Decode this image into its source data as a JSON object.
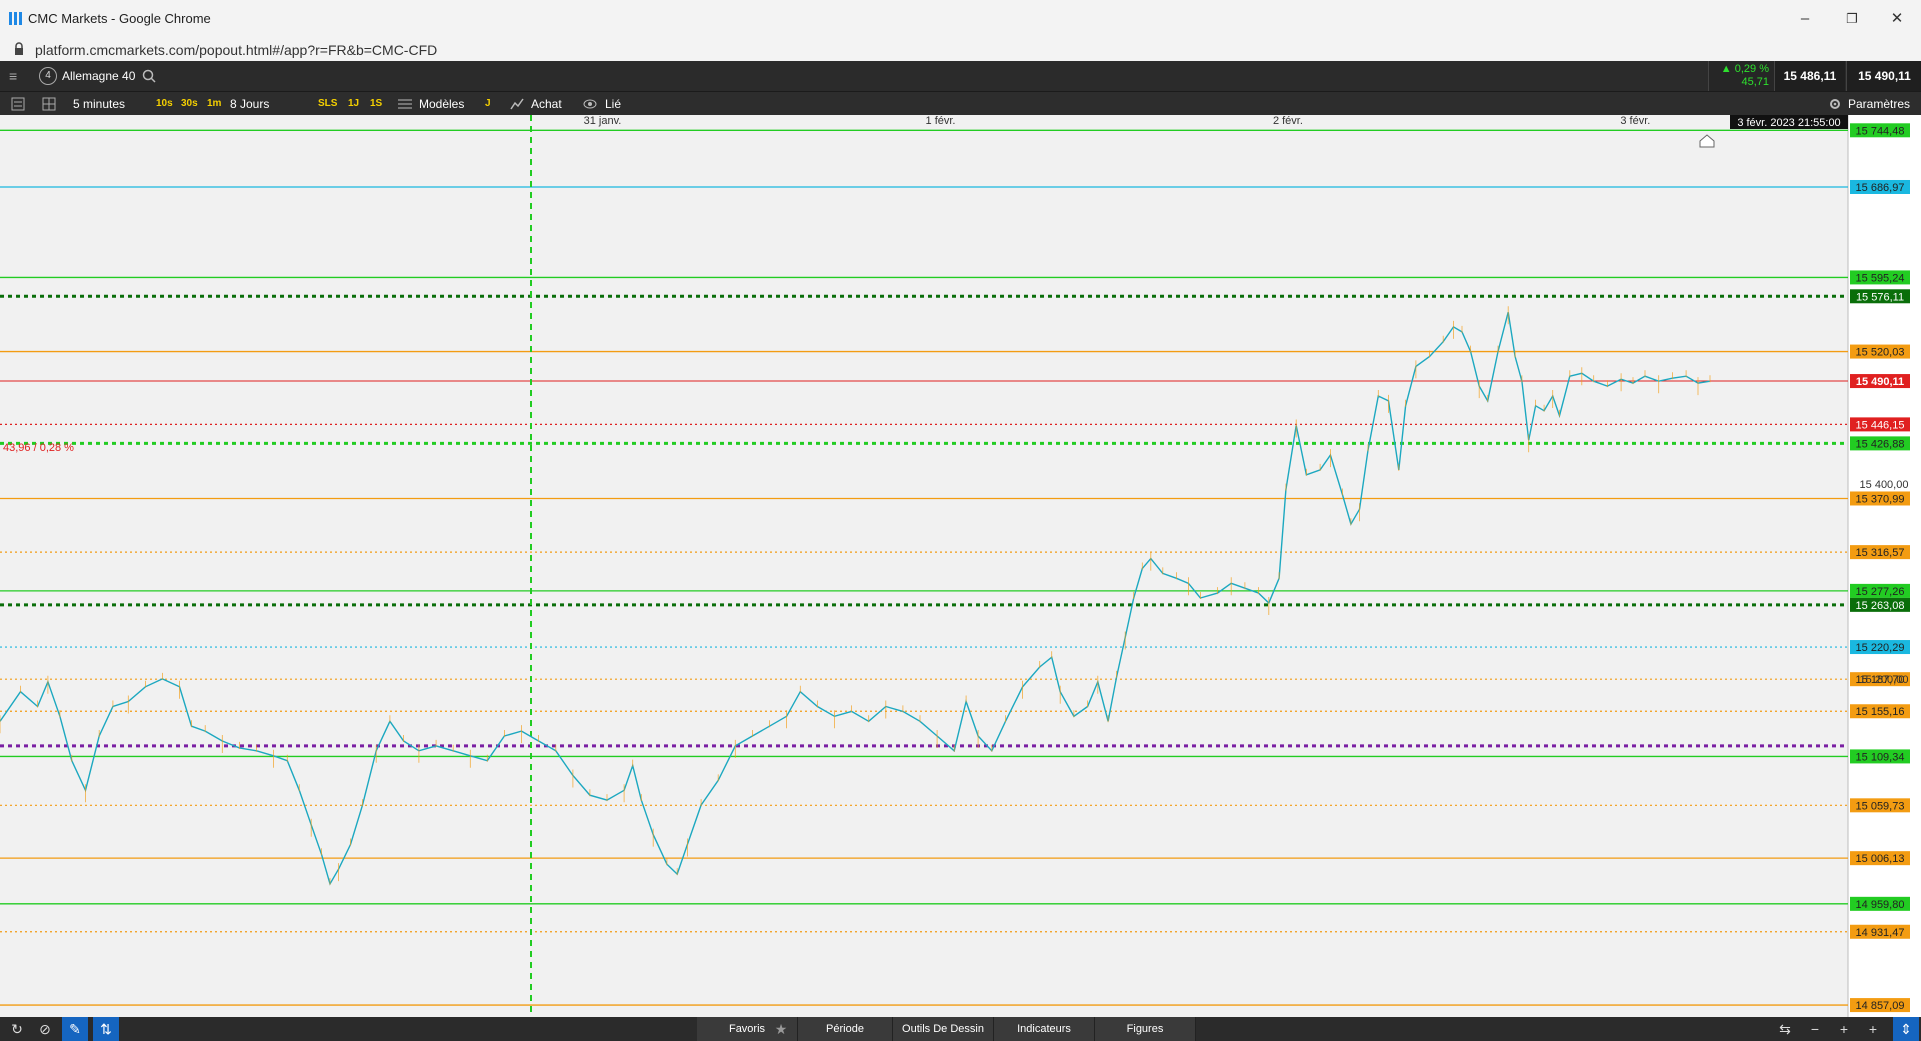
{
  "window": {
    "title": "CMC Markets - Google Chrome",
    "minimize": "–",
    "restore": "❐",
    "close": "✕"
  },
  "browser": {
    "url": "platform.cmcmarkets.com/popout.html#/app?r=FR&b=CMC-CFD"
  },
  "instrument": {
    "badge": "4",
    "name": "Allemagne 40",
    "change_pct": "▲ 0,29 %",
    "change_abs": "45,71",
    "sell_price": "15 486,11",
    "buy_price": "15 490,11"
  },
  "toolbar": {
    "interval": "5 minutes",
    "quick_intervals": [
      "10s",
      "30s",
      "1m"
    ],
    "range": "8 Jours",
    "range_buttons": [
      "SLS",
      "1J",
      "1S"
    ],
    "templates": "Modèles",
    "j_button": "J",
    "buy_label": "Achat",
    "linked_label": "Lié",
    "settings": "Paramètres"
  },
  "chart": {
    "date_ticks": [
      {
        "label": "31 janv.",
        "frac": 0.305
      },
      {
        "label": "1 févr.",
        "frac": 0.49
      },
      {
        "label": "2 févr.",
        "frac": 0.678
      },
      {
        "label": "3 févr.",
        "frac": 0.866
      }
    ],
    "crosshair_date": "3 févr. 2023 21:55:00",
    "change_annotation": "43,96 / 0,28 %",
    "colors": {
      "orange": "#f39c12",
      "green": "#22cc22",
      "cyan": "#1ab8e0",
      "red": "#e02020",
      "purple": "#7a1fa2",
      "darkgreen": "#0a6e0a",
      "price_line": "#1ca8c0"
    },
    "y_range": [
      14845,
      15760
    ],
    "price_axis_plain": [
      "15 400,00",
      "15 200,00"
    ],
    "levels": [
      {
        "price": 15744.48,
        "label": "15 744,48",
        "color": "green",
        "style": "solid"
      },
      {
        "price": 15686.97,
        "label": "15 686,97",
        "color": "cyan",
        "style": "solid"
      },
      {
        "price": 15595.24,
        "label": "15 595,24",
        "color": "green",
        "style": "solid"
      },
      {
        "price": 15576.11,
        "label": "15 576,11",
        "color": "darkgreen",
        "style": "dotted-thick"
      },
      {
        "price": 15520.03,
        "label": "15 520,03",
        "color": "orange",
        "style": "solid"
      },
      {
        "price": 15490.11,
        "label": "15 490,11",
        "color": "red",
        "style": "solid",
        "current": true
      },
      {
        "price": 15446.15,
        "label": "15 446,15",
        "color": "red",
        "style": "dotted"
      },
      {
        "price": 15426.88,
        "label": "15 426,88",
        "color": "green",
        "style": "dotted-thick"
      },
      {
        "price": 15370.99,
        "label": "15 370,99",
        "color": "orange",
        "style": "solid"
      },
      {
        "price": 15316.57,
        "label": "15 316,57",
        "color": "orange",
        "style": "dotted"
      },
      {
        "price": 15277.26,
        "label": "15 277,26",
        "color": "green",
        "style": "solid"
      },
      {
        "price": 15263.08,
        "label": "15 263,08",
        "color": "darkgreen",
        "style": "dotted-thick"
      },
      {
        "price": 15220.29,
        "label": "15 220,29",
        "color": "cyan",
        "style": "dotted"
      },
      {
        "price": 15187.7,
        "label": "15 187,70",
        "color": "orange",
        "style": "dotted"
      },
      {
        "price": 15155.16,
        "label": "15 155,16",
        "color": "orange",
        "style": "dotted"
      },
      {
        "price": 15120.0,
        "label": "",
        "color": "purple",
        "style": "dotted-thick"
      },
      {
        "price": 15109.34,
        "label": "15 109,34",
        "color": "green",
        "style": "solid"
      },
      {
        "price": 15059.73,
        "label": "15 059,73",
        "color": "orange",
        "style": "dotted"
      },
      {
        "price": 15006.13,
        "label": "15 006,13",
        "color": "orange",
        "style": "solid"
      },
      {
        "price": 14959.8,
        "label": "14 959,80",
        "color": "green",
        "style": "solid"
      },
      {
        "price": 14931.47,
        "label": "14 931,47",
        "color": "orange",
        "style": "dotted"
      },
      {
        "price": 14857.09,
        "label": "14 857,09",
        "color": "orange",
        "style": "solid"
      }
    ],
    "price_series": [
      [
        0.0,
        15145
      ],
      [
        0.012,
        15175
      ],
      [
        0.022,
        15160
      ],
      [
        0.028,
        15185
      ],
      [
        0.035,
        15150
      ],
      [
        0.042,
        15105
      ],
      [
        0.05,
        15075
      ],
      [
        0.058,
        15130
      ],
      [
        0.066,
        15160
      ],
      [
        0.075,
        15165
      ],
      [
        0.085,
        15180
      ],
      [
        0.095,
        15188
      ],
      [
        0.105,
        15180
      ],
      [
        0.112,
        15140
      ],
      [
        0.12,
        15135
      ],
      [
        0.13,
        15125
      ],
      [
        0.14,
        15118
      ],
      [
        0.15,
        15115
      ],
      [
        0.16,
        15110
      ],
      [
        0.168,
        15105
      ],
      [
        0.175,
        15075
      ],
      [
        0.182,
        15040
      ],
      [
        0.188,
        15010
      ],
      [
        0.193,
        14980
      ],
      [
        0.198,
        14995
      ],
      [
        0.205,
        15020
      ],
      [
        0.212,
        15060
      ],
      [
        0.22,
        15115
      ],
      [
        0.228,
        15145
      ],
      [
        0.236,
        15125
      ],
      [
        0.245,
        15115
      ],
      [
        0.255,
        15120
      ],
      [
        0.265,
        15115
      ],
      [
        0.275,
        15110
      ],
      [
        0.285,
        15105
      ],
      [
        0.295,
        15130
      ],
      [
        0.305,
        15135
      ],
      [
        0.315,
        15125
      ],
      [
        0.325,
        15115
      ],
      [
        0.335,
        15090
      ],
      [
        0.345,
        15070
      ],
      [
        0.355,
        15065
      ],
      [
        0.365,
        15075
      ],
      [
        0.37,
        15100
      ],
      [
        0.375,
        15065
      ],
      [
        0.382,
        15030
      ],
      [
        0.39,
        15000
      ],
      [
        0.396,
        14990
      ],
      [
        0.402,
        15020
      ],
      [
        0.41,
        15060
      ],
      [
        0.42,
        15085
      ],
      [
        0.43,
        15120
      ],
      [
        0.44,
        15130
      ],
      [
        0.45,
        15140
      ],
      [
        0.46,
        15150
      ],
      [
        0.468,
        15175
      ],
      [
        0.478,
        15160
      ],
      [
        0.488,
        15150
      ],
      [
        0.498,
        15155
      ],
      [
        0.508,
        15145
      ],
      [
        0.518,
        15160
      ],
      [
        0.528,
        15155
      ],
      [
        0.538,
        15145
      ],
      [
        0.548,
        15130
      ],
      [
        0.558,
        15115
      ],
      [
        0.565,
        15165
      ],
      [
        0.572,
        15130
      ],
      [
        0.58,
        15115
      ],
      [
        0.588,
        15145
      ],
      [
        0.598,
        15180
      ],
      [
        0.608,
        15200
      ],
      [
        0.615,
        15210
      ],
      [
        0.62,
        15175
      ],
      [
        0.628,
        15150
      ],
      [
        0.636,
        15160
      ],
      [
        0.642,
        15185
      ],
      [
        0.648,
        15145
      ],
      [
        0.653,
        15190
      ],
      [
        0.658,
        15230
      ],
      [
        0.663,
        15270
      ],
      [
        0.668,
        15300
      ],
      [
        0.673,
        15310
      ],
      [
        0.68,
        15295
      ],
      [
        0.688,
        15290
      ],
      [
        0.695,
        15285
      ],
      [
        0.702,
        15270
      ],
      [
        0.712,
        15275
      ],
      [
        0.72,
        15285
      ],
      [
        0.728,
        15280
      ],
      [
        0.736,
        15275
      ],
      [
        0.742,
        15265
      ],
      [
        0.748,
        15290
      ],
      [
        0.752,
        15380
      ],
      [
        0.758,
        15445
      ],
      [
        0.764,
        15395
      ],
      [
        0.772,
        15400
      ],
      [
        0.778,
        15415
      ],
      [
        0.785,
        15375
      ],
      [
        0.79,
        15345
      ],
      [
        0.795,
        15360
      ],
      [
        0.8,
        15420
      ],
      [
        0.806,
        15475
      ],
      [
        0.812,
        15470
      ],
      [
        0.818,
        15400
      ],
      [
        0.822,
        15465
      ],
      [
        0.828,
        15505
      ],
      [
        0.836,
        15515
      ],
      [
        0.844,
        15530
      ],
      [
        0.85,
        15545
      ],
      [
        0.855,
        15540
      ],
      [
        0.86,
        15520
      ],
      [
        0.865,
        15485
      ],
      [
        0.87,
        15470
      ],
      [
        0.876,
        15520
      ],
      [
        0.882,
        15560
      ],
      [
        0.886,
        15515
      ],
      [
        0.89,
        15490
      ],
      [
        0.894,
        15430
      ],
      [
        0.898,
        15465
      ],
      [
        0.903,
        15460
      ],
      [
        0.908,
        15475
      ],
      [
        0.912,
        15455
      ],
      [
        0.918,
        15495
      ],
      [
        0.925,
        15498
      ],
      [
        0.932,
        15490
      ],
      [
        0.94,
        15485
      ],
      [
        0.948,
        15492
      ],
      [
        0.955,
        15488
      ],
      [
        0.962,
        15495
      ],
      [
        0.97,
        15490
      ],
      [
        0.978,
        15493
      ],
      [
        0.986,
        15495
      ],
      [
        0.993,
        15488
      ],
      [
        1.0,
        15490
      ]
    ]
  },
  "bottombar": {
    "favorites": "Favoris",
    "period": "Période",
    "drawing_tools": "Outils De Dessin",
    "indicators": "Indicateurs",
    "figures": "Figures"
  }
}
